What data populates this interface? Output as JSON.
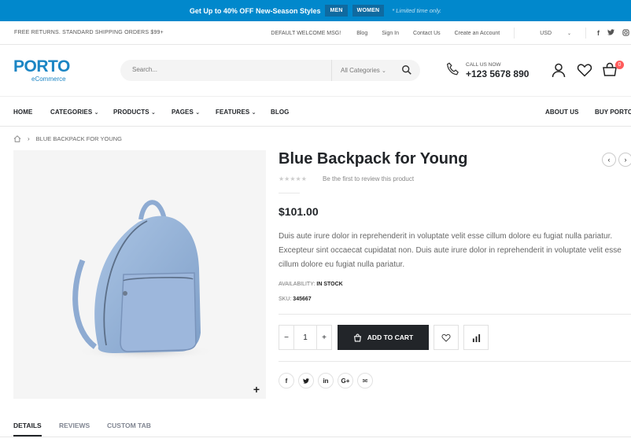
{
  "promo": {
    "text_prefix": "Get Up to ",
    "highlight": "40% OFF",
    "text_suffix": " New-Season Styles",
    "tag_men": "MEN",
    "tag_women": "WOMEN",
    "note": "* Limited time only."
  },
  "topbar": {
    "left": "FREE RETURNS. STANDARD SHIPPING ORDERS $99+",
    "welcome": "DEFAULT WELCOME MSG!",
    "blog": "Blog",
    "signin": "Sign In",
    "contact": "Contact Us",
    "create": "Create an Account",
    "currency": "USD",
    "social": [
      "f",
      "t",
      "ig"
    ]
  },
  "header": {
    "brand": "PORTO",
    "sub": "eCommerce",
    "search_placeholder": "Search...",
    "category": "All Categories",
    "call_label": "CALL US NOW",
    "phone": "+123 5678 890",
    "cart_count": "0"
  },
  "nav": {
    "home": "HOME",
    "categories": "CATEGORIES",
    "products": "PRODUCTS",
    "pages": "PAGES",
    "features": "FEATURES",
    "blog": "BLOG",
    "about": "ABOUT US",
    "buy": "BUY PORTO"
  },
  "breadcrumb": {
    "current": "BLUE BACKPACK FOR YOUNG"
  },
  "product": {
    "title": "Blue Backpack for Young",
    "stars": "★★★★★",
    "review_text": "Be the first to review this product",
    "price": "$101.00",
    "description": "Duis aute irure dolor in reprehenderit in voluptate velit esse cillum dolore eu fugiat nulla pariatur. Excepteur sint occaecat cupidatat non. Duis aute irure dolor in reprehenderit in voluptate velit esse cillum dolore eu fugiat nulla pariatur.",
    "availability_label": "AVAILABILITY: ",
    "availability_value": "IN STOCK",
    "sku_label": "SKU: ",
    "sku_value": "345667",
    "qty": "1",
    "add_to_cart": "ADD TO CART",
    "share": [
      "f",
      "t",
      "in",
      "G+",
      "✉"
    ]
  },
  "tabs": {
    "details": "DETAILS",
    "reviews": "REVIEWS",
    "custom": "CUSTOM TAB"
  },
  "colors": {
    "accent": "#0188cc",
    "dark": "#222529",
    "badge": "#ff5b5b"
  }
}
